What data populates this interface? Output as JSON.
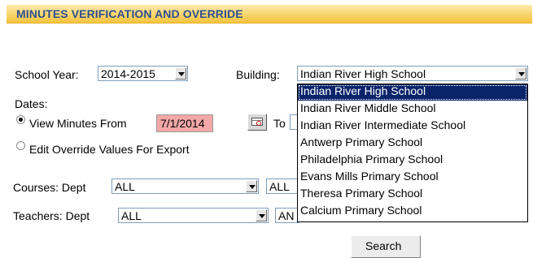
{
  "header": {
    "title": "MINUTES VERIFICATION AND OVERRIDE"
  },
  "filters": {
    "school_year_label": "School Year:",
    "school_year_value": "2014-2015",
    "building_label": "Building:",
    "building_value": "Indian River High School"
  },
  "dates": {
    "label": "Dates:",
    "view_option_label": "View Minutes From",
    "from_value": "7/1/2014",
    "to_label": "To",
    "edit_option_label": "Edit Override Values For Export"
  },
  "courses": {
    "label": "Courses: Dept",
    "dept_value": "ALL",
    "second_value": "ALL"
  },
  "teachers": {
    "label": "Teachers: Dept",
    "dept_value": "ALL",
    "second_value": "AN"
  },
  "building_options": [
    "Indian River High School",
    "Indian River Middle School",
    "Indian River Intermediate School",
    "Antwerp Primary School",
    "Philadelphia Primary School",
    "Evans Mills Primary School",
    "Theresa Primary School",
    "Calcium Primary School"
  ],
  "search_label": "Search"
}
